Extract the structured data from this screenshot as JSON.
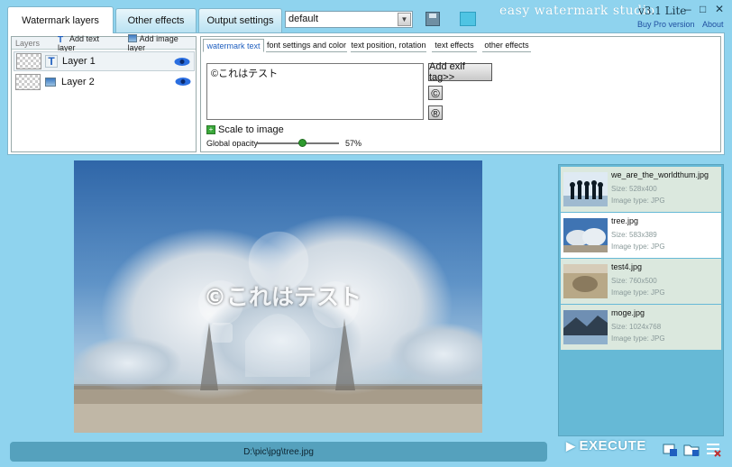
{
  "tabs": [
    {
      "label": "Watermark layers",
      "active": true
    },
    {
      "label": "Other effects",
      "active": false
    },
    {
      "label": "Output settings",
      "active": false
    }
  ],
  "preset": {
    "value": "default"
  },
  "app": {
    "title": "easy watermark studio",
    "version": "v3.1 Lite",
    "pro_link": "Buy Pro version",
    "about_link": "About"
  },
  "window_controls": {
    "minimize": "–",
    "maximize": "□",
    "close": "✕"
  },
  "layers": {
    "header": "Layers",
    "add_text": "Add text layer",
    "add_image": "Add image layer",
    "items": [
      {
        "name": "Layer 1",
        "type": "text",
        "visible": true,
        "selected": true
      },
      {
        "name": "Layer 2",
        "type": "image",
        "visible": true,
        "selected": false
      }
    ]
  },
  "subtabs": [
    {
      "label": "watermark text",
      "active": true
    },
    {
      "label": "font settings and color",
      "active": false
    },
    {
      "label": "text position, rotation",
      "active": false
    },
    {
      "label": "text effects",
      "active": false
    },
    {
      "label": "other effects",
      "active": false
    }
  ],
  "watermark": {
    "text": "©これはテスト",
    "exif_button": "Add exif tag>>",
    "copyright_symbol": "©",
    "registered_symbol": "®",
    "scale_to_image": "Scale to image",
    "opacity_label": "Global opacity",
    "opacity_value": "57%",
    "opacity_fraction": 0.57
  },
  "preview": {
    "overlay_text": "©これはテスト"
  },
  "files": [
    {
      "name": "we_are_the_worldthum.jpg",
      "size": "Size:  528x400",
      "type": "Image type:  JPG",
      "selected": false
    },
    {
      "name": "tree.jpg",
      "size": "Size:  583x389",
      "type": "Image type:  JPG",
      "selected": true
    },
    {
      "name": "test4.jpg",
      "size": "Size:  760x500",
      "type": "Image type:  JPG",
      "selected": false
    },
    {
      "name": "moge.jpg",
      "size": "Size:  1024x768",
      "type": "Image type:  JPG",
      "selected": false
    }
  ],
  "status": {
    "path": "D:\\pic\\jpg\\tree.jpg"
  },
  "execute": {
    "label": "EXECUTE"
  },
  "colors": {
    "background": "#8fd3ee",
    "accent": "#1f5fbf",
    "execute_text": "#ffffff"
  }
}
